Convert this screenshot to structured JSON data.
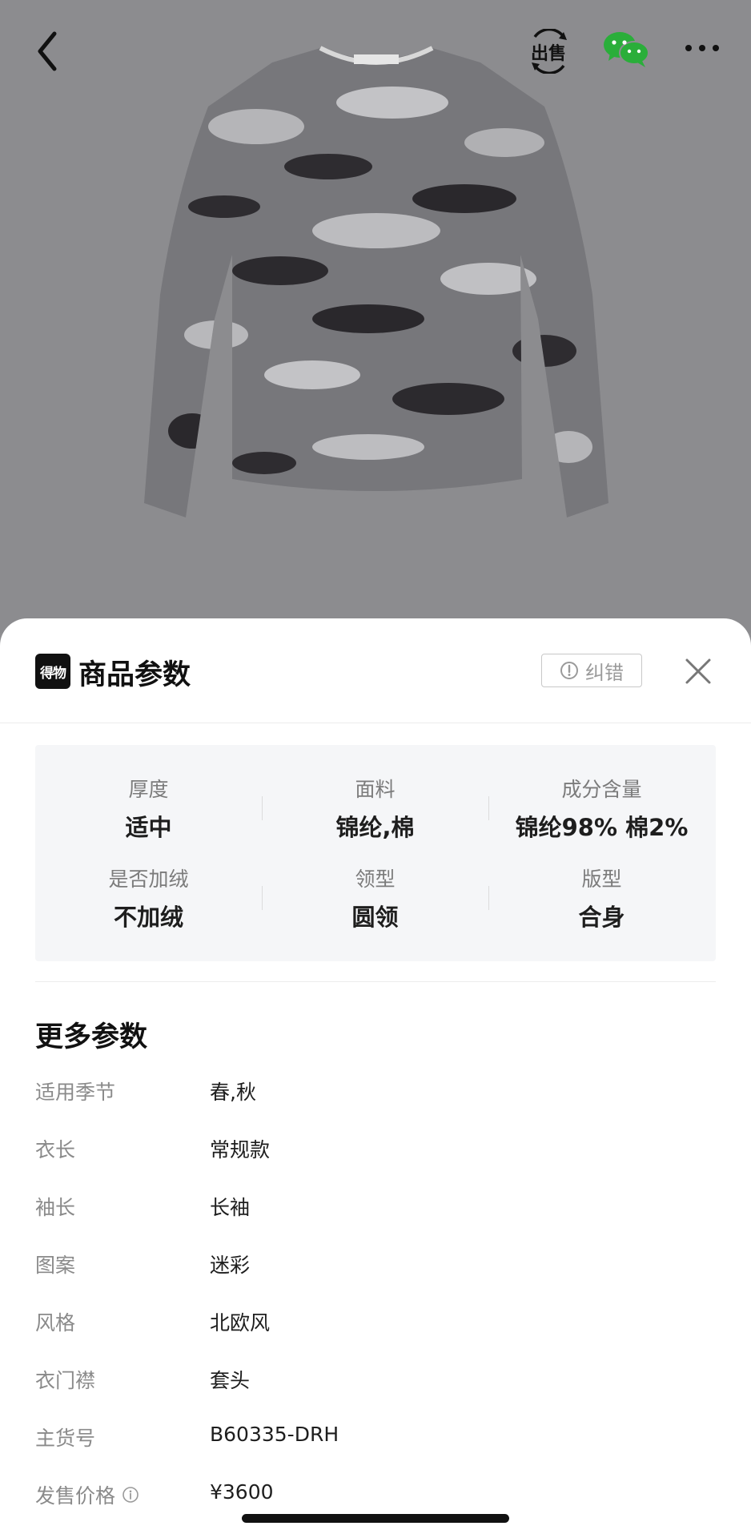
{
  "colors": {
    "overlay": "#8c8c8f",
    "sheet_bg": "#ffffff",
    "card_bg": "#f5f6f8",
    "label_gray": "#8a8a8a",
    "wechat_green": "#2aae3a"
  },
  "topbar": {
    "icons": [
      "back-arrow-icon",
      "sell-icon",
      "wechat-icon",
      "more-dots-icon"
    ],
    "sell_label": "出售"
  },
  "product": {
    "image_desc": "grey camouflage sweater"
  },
  "sheet": {
    "brand_logo_text": "得物",
    "title": "商品参数",
    "report_label": "纠错",
    "key_params": [
      {
        "label": "厚度",
        "value": "适中"
      },
      {
        "label": "面料",
        "value": "锦纶,棉"
      },
      {
        "label": "成分含量",
        "value": "锦纶98% 棉2%"
      },
      {
        "label": "是否加绒",
        "value": "不加绒"
      },
      {
        "label": "领型",
        "value": "圆领"
      },
      {
        "label": "版型",
        "value": "合身"
      }
    ],
    "more_title": "更多参数",
    "more_params": [
      {
        "label": "适用季节",
        "value": "春,秋"
      },
      {
        "label": "衣长",
        "value": "常规款"
      },
      {
        "label": "袖长",
        "value": "长袖"
      },
      {
        "label": "图案",
        "value": "迷彩"
      },
      {
        "label": "风格",
        "value": "北欧风"
      },
      {
        "label": "衣门襟",
        "value": "套头"
      },
      {
        "label": "主货号",
        "value": "B60335-DRH"
      },
      {
        "label": "发售价格",
        "value": "¥3600"
      }
    ]
  }
}
